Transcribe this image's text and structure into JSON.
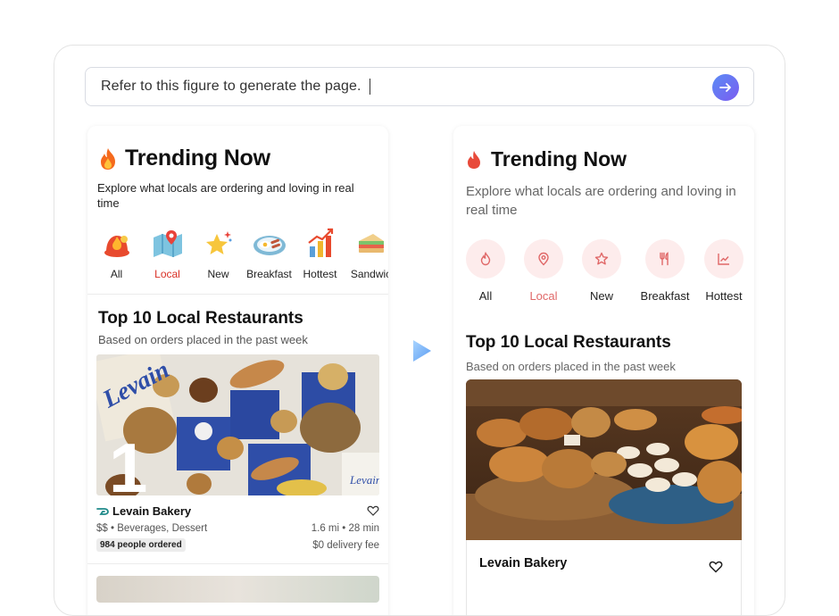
{
  "prompt": {
    "text": "Refer to this figure to generate the page.",
    "send_icon": "arrow-right-icon"
  },
  "left": {
    "title": "Trending Now",
    "title_icon": "fire-icon",
    "subtitle": "Explore what locals are ordering and loving in real time",
    "categories": [
      {
        "label": "All",
        "icon": "fire-helmet-icon",
        "active": false
      },
      {
        "label": "Local",
        "icon": "map-pin-icon",
        "active": true
      },
      {
        "label": "New",
        "icon": "sparkle-star-icon",
        "active": false
      },
      {
        "label": "Breakfast",
        "icon": "breakfast-plate-icon",
        "active": false
      },
      {
        "label": "Hottest",
        "icon": "trending-chart-icon",
        "active": false
      },
      {
        "label": "Sandwic",
        "icon": "sandwich-icon",
        "active": false
      }
    ],
    "section_title": "Top 10 Local Restaurants",
    "section_sub": "Based on orders placed in the past week",
    "card": {
      "rank": "1",
      "logo_text": "Levain",
      "name": "Levain Bakery",
      "price_tags": "$$ • Beverages, Dessert",
      "distance_time": "1.6 mi • 28 min",
      "badge": "984 people ordered",
      "fee": "$0 delivery fee"
    },
    "accent": "#d93025"
  },
  "right": {
    "title": "Trending Now",
    "title_icon": "drop-icon",
    "subtitle": "Explore what locals are ordering and loving in real time",
    "categories": [
      {
        "label": "All",
        "icon": "flame-outline-icon",
        "active": false
      },
      {
        "label": "Local",
        "icon": "location-pin-icon",
        "active": true
      },
      {
        "label": "New",
        "icon": "star-outline-icon",
        "active": false
      },
      {
        "label": "Breakfast",
        "icon": "utensils-icon",
        "active": false
      },
      {
        "label": "Hottest",
        "icon": "line-chart-icon",
        "active": false
      }
    ],
    "section_title": "Top 10 Local Restaurants",
    "section_sub": "Based on orders placed in the past week",
    "card": {
      "name": "Levain Bakery"
    },
    "accent": "#e06868",
    "chip_bg": "#fdecec"
  }
}
